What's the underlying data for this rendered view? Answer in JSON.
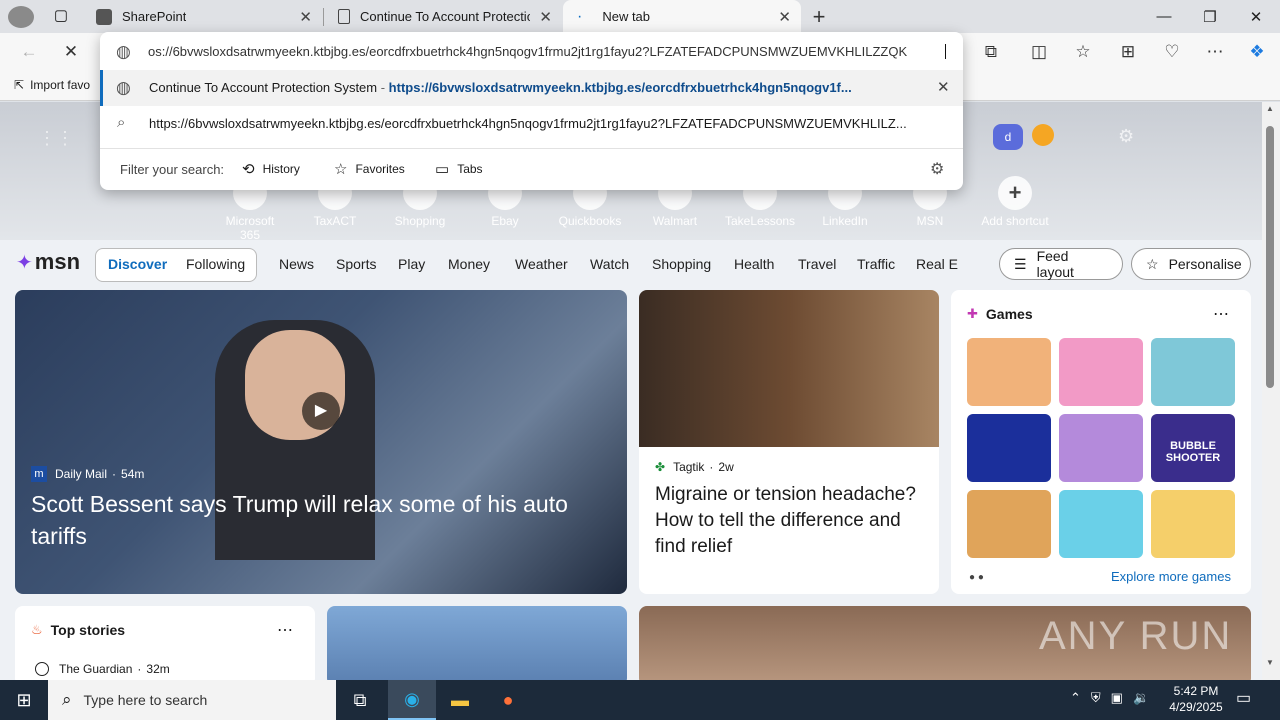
{
  "tabs": [
    {
      "label": "SharePoint"
    },
    {
      "label": "Continue To Account Protection"
    },
    {
      "label": "New tab"
    }
  ],
  "address": {
    "value": "os://6bvwsloxdsatrwmyeekn.ktbjbg.es/eorcdfrxbuetrhck4hgn5nqogv1frmu2jt1rg1fayu2?LFZATEFADCPUNSMWZUEMVKHLILZZQK"
  },
  "suggestions": {
    "top_title": "Continue To Account Protection System",
    "top_sep": " - ",
    "top_url": "https://6bvwsloxdsatrwmyeekn.ktbjbg.es/eorcdfrxbuetrhck4hgn5nqogv1f...",
    "search_text": "https://6bvwsloxdsatrwmyeekn.ktbjbg.es/eorcdfrxbuetrhck4hgn5nqogv1frmu2jt1rg1fayu2?LFZATEFADCPUNSMWZUEMVKHLILZ...",
    "filter_label": "Filter your search:",
    "filters": [
      "History",
      "Favorites",
      "Tabs"
    ]
  },
  "bookmarks": {
    "import": "Import favo"
  },
  "shortcuts": [
    "Microsoft 365",
    "TaxACT",
    "Shopping",
    "Ebay",
    "Quickbooks",
    "Walmart",
    "TakeLessons",
    "LinkedIn",
    "MSN",
    "Add shortcut"
  ],
  "msn": {
    "logo": "msn",
    "toggle": [
      "Discover",
      "Following"
    ],
    "nav": [
      "News",
      "Sports",
      "Play",
      "Money",
      "Weather",
      "Watch",
      "Shopping",
      "Health",
      "Travel",
      "Traffic",
      "Real E"
    ],
    "feed_layout": "Feed layout",
    "personalise": "Personalise"
  },
  "hero_story": {
    "source": "Daily Mail",
    "age": "54m",
    "headline": "Scott Bessent says Trump will relax some of his auto tariffs"
  },
  "side_story": {
    "source": "Tagtik",
    "age": "2w",
    "headline": "Migraine or tension headache? How to tell the difference and find relief"
  },
  "games": {
    "title": "Games",
    "more": "Explore more games",
    "tile_text": "BUBBLE SHOOTER"
  },
  "top_stories": {
    "title": "Top stories",
    "source": "The Guardian",
    "age": "32m"
  },
  "watermark": "ANY RUN",
  "taskbar": {
    "search_placeholder": "Type here to search",
    "time": "5:42 PM",
    "date": "4/29/2025"
  }
}
